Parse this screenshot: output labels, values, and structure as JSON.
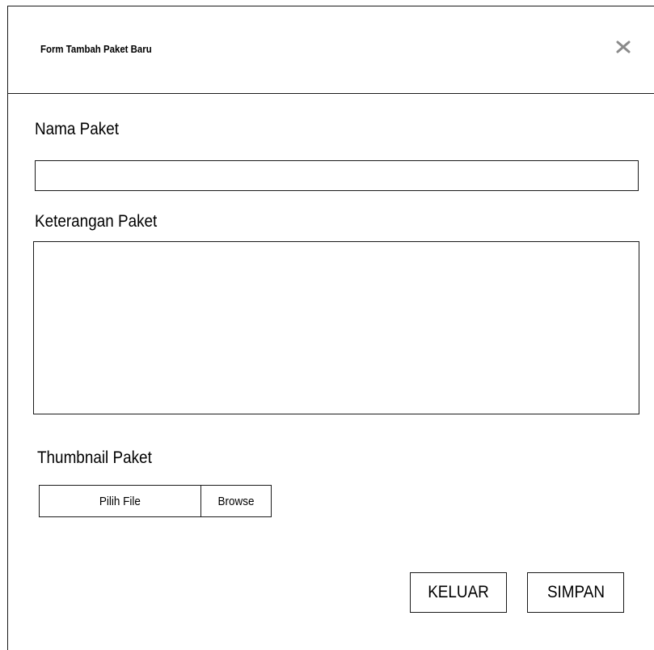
{
  "dialog": {
    "title": "Form Tambah Paket Baru",
    "close_icon": "close-icon"
  },
  "form": {
    "nama_paket": {
      "label": "Nama Paket",
      "value": ""
    },
    "keterangan_paket": {
      "label": "Keterangan Paket",
      "value": ""
    },
    "thumbnail_paket": {
      "label": "Thumbnail Paket",
      "file_placeholder": "Pilih File",
      "browse_label": "Browse"
    }
  },
  "actions": {
    "keluar_label": "KELUAR",
    "simpan_label": "SIMPAN"
  },
  "colors": {
    "border": "#1a1a1a",
    "close_icon": "#8a8a8a",
    "background": "#ffffff"
  }
}
